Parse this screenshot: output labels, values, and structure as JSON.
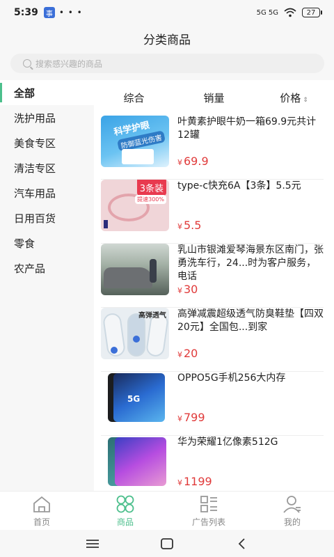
{
  "status": {
    "time": "5:39",
    "app_badge": "事",
    "dots": "• • •",
    "network": "5G 5G",
    "battery": "27"
  },
  "header": {
    "title": "分类商品"
  },
  "search": {
    "placeholder": "搜索感兴趣的商品"
  },
  "sidebar": {
    "items": [
      {
        "label": "全部",
        "active": true
      },
      {
        "label": "洗护用品"
      },
      {
        "label": "美食专区"
      },
      {
        "label": "清洁专区"
      },
      {
        "label": "汽车用品"
      },
      {
        "label": "日用百货"
      },
      {
        "label": "零食"
      },
      {
        "label": "农产品"
      }
    ]
  },
  "sort": {
    "comprehensive": "综合",
    "sales": "销量",
    "price": "价格"
  },
  "products": [
    {
      "title": "叶黄素护眼牛奶一箱69.9元共计12罐",
      "currency": "¥",
      "price": "69.9",
      "thumb_text1": "科学护眼",
      "thumb_text2": "防御蓝光伤害"
    },
    {
      "title": "type-c快充6A【3条】5.5元",
      "currency": "¥",
      "price": "5.5",
      "thumb_tag": "3条装",
      "thumb_tag2": "提速300%"
    },
    {
      "title": "乳山市银滩爱琴海景东区南门，张勇洗车行，24...时为客户服务，电话",
      "currency": "¥",
      "price": "30"
    },
    {
      "title": "高弹减震超级透气防臭鞋垫【四双20元】全国包...到家",
      "currency": "¥",
      "price": "20",
      "thumb_text1": "高弹透气"
    },
    {
      "title": "OPPO5G手机256大内存",
      "currency": "¥",
      "price": "799",
      "thumb_text1": "5G"
    },
    {
      "title": "华为荣耀1亿像素512G",
      "currency": "¥",
      "price": "1199"
    }
  ],
  "tabs": [
    {
      "label": "首页",
      "icon": "home-icon"
    },
    {
      "label": "商品",
      "icon": "grid-icon",
      "active": true
    },
    {
      "label": "广告列表",
      "icon": "list-icon"
    },
    {
      "label": "我的",
      "icon": "user-icon"
    }
  ],
  "colors": {
    "accent": "#4cbf8c",
    "price": "#e03a3a"
  }
}
